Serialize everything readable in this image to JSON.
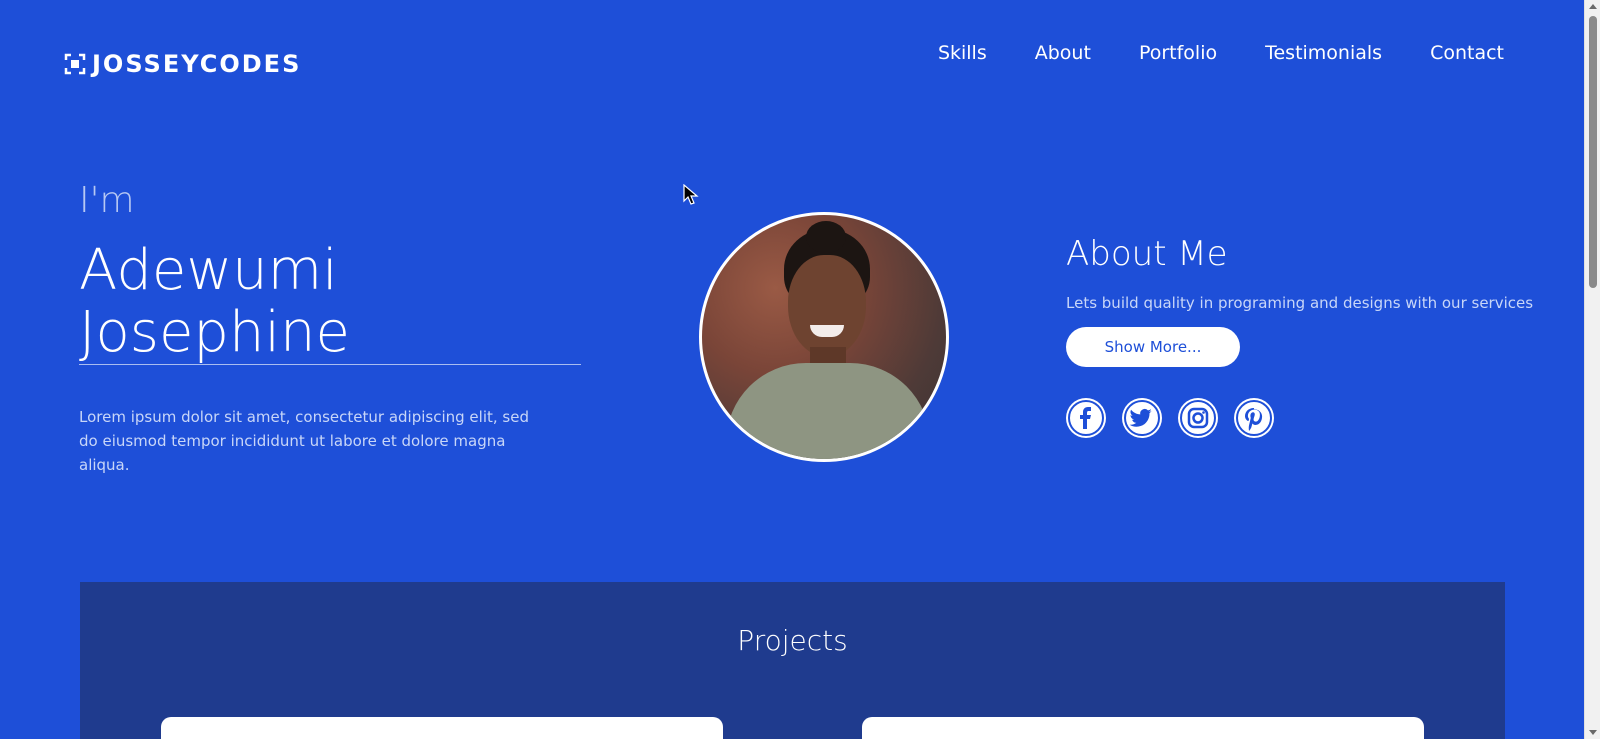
{
  "brand": {
    "name": "JOSSEYCODES",
    "icon": "logo-bracket-icon"
  },
  "nav": {
    "items": [
      {
        "label": "Skills"
      },
      {
        "label": "About"
      },
      {
        "label": "Portfolio"
      },
      {
        "label": "Testimonials"
      },
      {
        "label": "Contact"
      }
    ]
  },
  "hero": {
    "intro": "I'm",
    "name": "Adewumi Josephine",
    "description": "Lorem ipsum dolor sit amet, consectetur adipiscing elit, sed do eiusmod tempor incididunt ut labore et dolore magna aliqua."
  },
  "about": {
    "title": "About Me",
    "text": "Lets build quality in programing and designs with our services",
    "button_label": "Show More...",
    "socials": [
      {
        "icon": "facebook-icon"
      },
      {
        "icon": "twitter-icon"
      },
      {
        "icon": "instagram-icon"
      },
      {
        "icon": "pinterest-icon"
      }
    ]
  },
  "projects": {
    "title": "Projects"
  },
  "colors": {
    "background": "#1e4fd8",
    "projects_bg": "#1f3b8e",
    "accent_text": "#c8d6f8",
    "white": "#ffffff"
  }
}
